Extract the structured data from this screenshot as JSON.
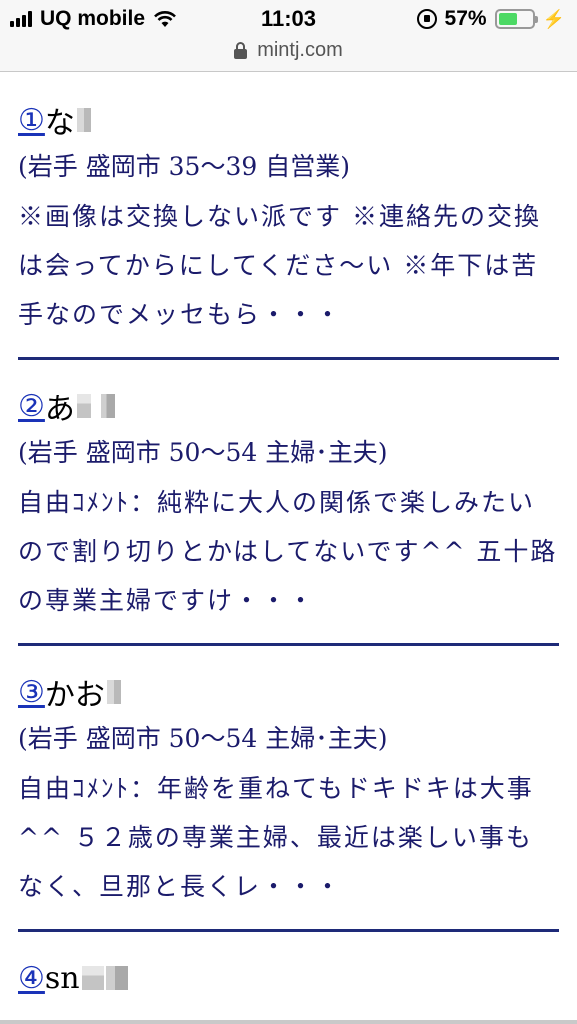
{
  "status_bar": {
    "carrier": "UQ mobile",
    "time": "11:03",
    "battery_percent": "57%",
    "battery_level": 0.57
  },
  "browser": {
    "url": "mintj.com"
  },
  "entries": [
    {
      "number": "①",
      "name": "な",
      "info": "(岩手 盛岡市 35〜39 自営業)",
      "text": "※画像は交換しない派です ※連絡先の交換は会ってからにしてくださ〜い ※年下は苦手なのでメッセもら・・・"
    },
    {
      "number": "②",
      "name": "あ",
      "info": "(岩手 盛岡市 50〜54 主婦･主夫)",
      "text": "自由ｺﾒﾝﾄ：純粋に大人の関係で楽しみたいので割り切りとかはしてないです^^ 五十路の専業主婦ですけ・・・"
    },
    {
      "number": "③",
      "name": "かお",
      "info": "(岩手 盛岡市 50〜54 主婦･主夫)",
      "text": "自由ｺﾒﾝﾄ：年齢を重ねてもドキドキは大事^^ ５２歳の専業主婦、最近は楽しい事もなく、旦那と長くレ・・・"
    },
    {
      "number": "④",
      "name": "sn"
    }
  ]
}
